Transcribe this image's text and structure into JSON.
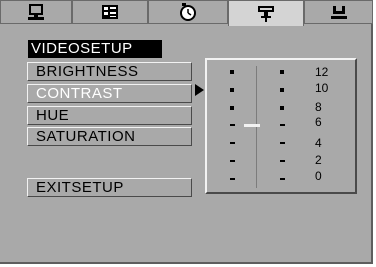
{
  "tabs": [
    {
      "name": "monitor-icon",
      "active": false
    },
    {
      "name": "audio-settings-icon",
      "active": false
    },
    {
      "name": "clock-icon",
      "active": false
    },
    {
      "name": "video-settings-icon",
      "active": true
    },
    {
      "name": "speaker-preference-icon",
      "active": false
    }
  ],
  "menu": {
    "title": "VIDEOSETUP",
    "items": [
      {
        "label": "BRIGHTNESS",
        "selected": false
      },
      {
        "label": "CONTRAST",
        "selected": true
      },
      {
        "label": "HUE",
        "selected": false
      },
      {
        "label": "SATURATION",
        "selected": false
      }
    ],
    "exit_label": "EXITSETUP"
  },
  "slider": {
    "values": [
      "12",
      "10",
      "8",
      "6",
      "4",
      "2",
      "0"
    ],
    "current": "6"
  },
  "colors": {
    "background": "#a9a9a9",
    "title_bg": "#000000",
    "selected_text": "#ffffff"
  }
}
